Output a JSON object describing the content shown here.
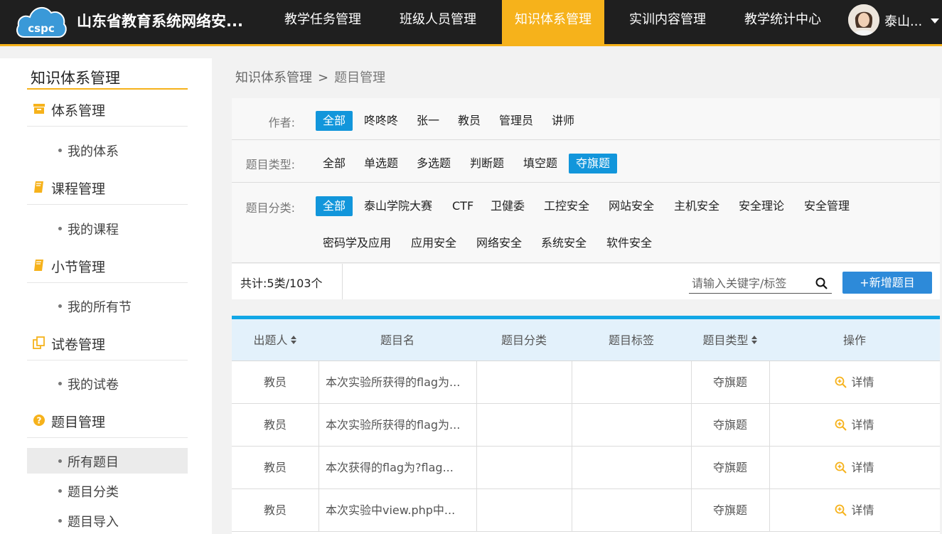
{
  "header": {
    "logo_text": "cspc",
    "app_title": "山东省教育系统网络安...",
    "nav": [
      {
        "label": "教学任务管理",
        "active": false
      },
      {
        "label": "班级人员管理",
        "active": false
      },
      {
        "label": "知识体系管理",
        "active": true
      },
      {
        "label": "实训内容管理",
        "active": false
      },
      {
        "label": "教学统计中心",
        "active": false
      }
    ],
    "user": {
      "name": "泰山..."
    }
  },
  "sidebar": {
    "title": "知识体系管理",
    "groups": [
      {
        "label": "体系管理",
        "icon": "box-icon",
        "items": [
          {
            "label": "我的体系",
            "active": false
          }
        ]
      },
      {
        "label": "课程管理",
        "icon": "book-icon",
        "items": [
          {
            "label": "我的课程",
            "active": false
          }
        ]
      },
      {
        "label": "小节管理",
        "icon": "book-icon",
        "items": [
          {
            "label": "我的所有节",
            "active": false
          }
        ]
      },
      {
        "label": "试卷管理",
        "icon": "copy-icon",
        "items": [
          {
            "label": "我的试卷",
            "active": false
          }
        ]
      },
      {
        "label": "题目管理",
        "icon": "question-circle-icon",
        "items": [
          {
            "label": "所有题目",
            "active": true
          },
          {
            "label": "题目分类",
            "active": false
          },
          {
            "label": "题目导入",
            "active": false
          }
        ]
      }
    ]
  },
  "breadcrumb": {
    "parent": "知识体系管理",
    "separator": ">",
    "current": "题目管理"
  },
  "filters": {
    "author": {
      "label": "作者:",
      "options": [
        "全部",
        "咚咚咚",
        "张一",
        "教员",
        "管理员",
        "讲师"
      ],
      "selected": "全部"
    },
    "type": {
      "label": "题目类型:",
      "options": [
        "全部",
        "单选题",
        "多选题",
        "判断题",
        "填空题",
        "夺旗题"
      ],
      "selected": "夺旗题"
    },
    "category": {
      "label": "题目分类:",
      "options": [
        "全部",
        "泰山学院大赛",
        "CTF",
        "卫健委",
        "工控安全",
        "网站安全",
        "主机安全",
        "安全理论",
        "安全管理",
        "密码学及应用",
        "应用安全",
        "网络安全",
        "系统安全",
        "软件安全"
      ],
      "selected": "全部"
    }
  },
  "toolbar": {
    "total": "共计:5类/103个",
    "search_placeholder": "请输入关键字/标签",
    "add_button": "+新增题目"
  },
  "table": {
    "columns": [
      "出题人",
      "题目名",
      "题目分类",
      "题目标签",
      "题目类型",
      "操作"
    ],
    "rows": [
      {
        "author": "教员",
        "name": "本次实验所获得的flag为...",
        "category": "",
        "tags": "",
        "type": "夺旗题",
        "action": "详情"
      },
      {
        "author": "教员",
        "name": "本次实验所获得的flag为...",
        "category": "",
        "tags": "",
        "type": "夺旗题",
        "action": "详情"
      },
      {
        "author": "教员",
        "name": "本次获得的flag为?flag...",
        "category": "",
        "tags": "",
        "type": "夺旗题",
        "action": "详情"
      },
      {
        "author": "教员",
        "name": "本次实验中view.php中...",
        "category": "",
        "tags": "",
        "type": "夺旗题",
        "action": "详情"
      }
    ]
  },
  "colors": {
    "accent": "#f6b21b",
    "primary": "#1296db",
    "button": "#2d8ad9",
    "header_bg": "#1f1f1f",
    "table_head_bg": "#e3f1fb"
  }
}
